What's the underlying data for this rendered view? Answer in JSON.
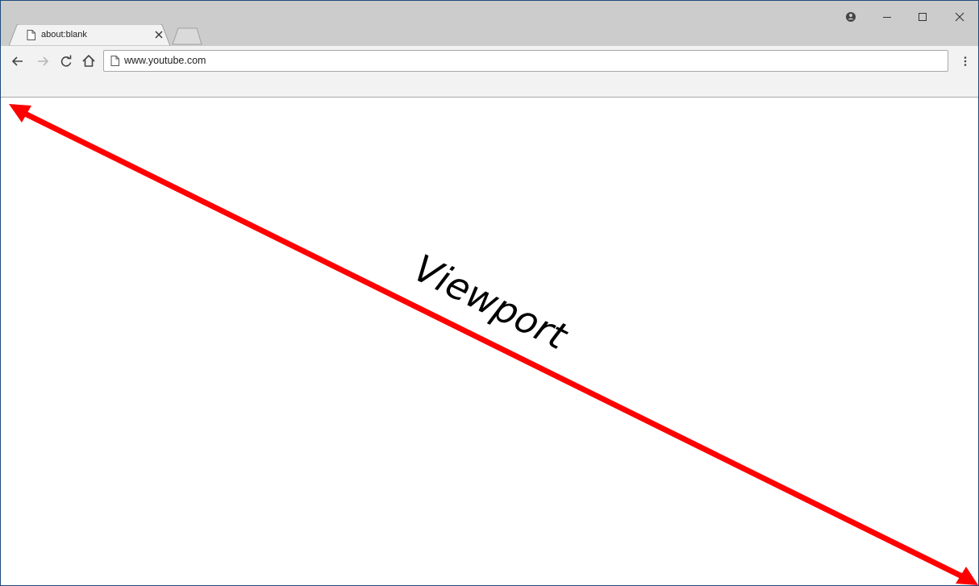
{
  "browser": {
    "tab": {
      "title": "about:blank",
      "favicon": "page-icon",
      "close_icon": "close-icon"
    },
    "new_tab_icon": "new-tab-icon",
    "window_controls": {
      "profile_icon": "profile-icon",
      "minimize_icon": "minimize-icon",
      "maximize_icon": "maximize-icon",
      "close_icon": "close-icon"
    },
    "toolbar": {
      "back_icon": "arrow-left-icon",
      "forward_icon": "arrow-right-icon",
      "reload_icon": "reload-icon",
      "home_icon": "home-icon",
      "menu_icon": "vertical-dots-icon",
      "address": "www.youtube.com",
      "address_icon": "page-icon"
    }
  },
  "annotation": {
    "label": "Viewport",
    "arrow_color": "#ff0000",
    "text_color": "#000000"
  },
  "colors": {
    "titlebar": "#cccccc",
    "toolbar": "#f2f2f2",
    "window_border": "#1e4a7a"
  }
}
